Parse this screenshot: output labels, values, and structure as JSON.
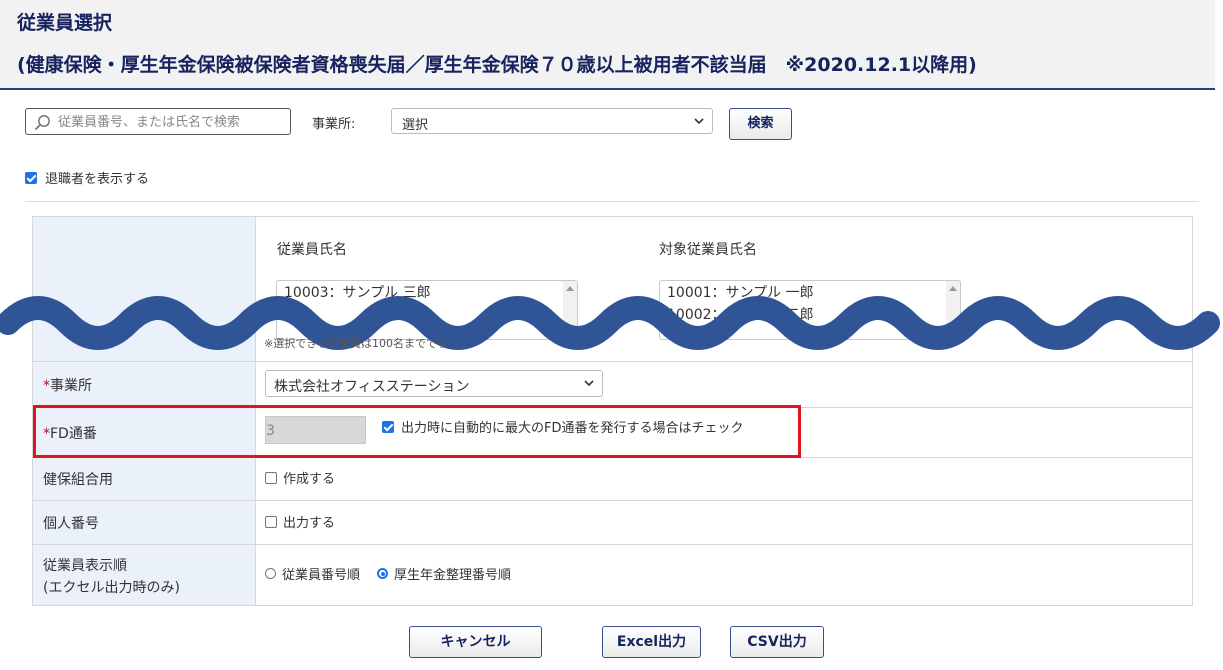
{
  "header": {
    "title": "従業員選択",
    "subtitle": "(健康保険・厚生年金保険被保険者資格喪失届／厚生年金保険７０歳以上被用者不該当届　※2020.12.1以降用)"
  },
  "search": {
    "placeholder": "従業員番号、または氏名で検索",
    "office_label": "事業所:",
    "office_value": "選択",
    "button": "検索"
  },
  "retired": {
    "label": "退職者を表示する",
    "checked": true
  },
  "selection": {
    "employee_title": "従業員氏名",
    "target_title": "対象従業員氏名",
    "employees": [
      "10003：サンプル 三郎"
    ],
    "targets": [
      "10001：サンプル 一郎",
      "10002：サンプル 二郎"
    ],
    "note": "※選択できる従業員は100名までです。"
  },
  "form": {
    "office_label": "事業所",
    "office_value": "株式会社オフィスステーション",
    "fd_label": "FD通番",
    "fd_value": "3",
    "fd_auto_label": "出力時に自動的に最大のFD通番を発行する場合はチェック",
    "kenpo_label": "健保組合用",
    "kenpo_option": "作成する",
    "mynumber_label": "個人番号",
    "mynumber_option": "出力する",
    "order_label_1": "従業員表示順",
    "order_label_2": "(エクセル出力時のみ)",
    "order_opt_1": "従業員番号順",
    "order_opt_2": "厚生年金整理番号順",
    "required_mark": "*"
  },
  "buttons": {
    "cancel": "キャンセル",
    "excel": "Excel出力",
    "csv": "CSV出力"
  },
  "colors": {
    "accent": "#1a73e8",
    "highlight": "#e0161b",
    "wave": "#2f5597",
    "title": "#16235e"
  }
}
